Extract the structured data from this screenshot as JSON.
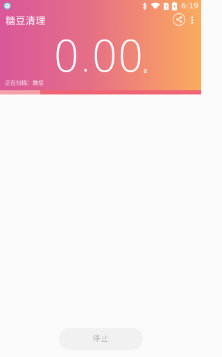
{
  "status_bar": {
    "time": "6:19",
    "icons": [
      "app-notification-icon",
      "bluetooth-icon",
      "wifi-icon",
      "no-sim-icon",
      "battery-charging-icon"
    ]
  },
  "app": {
    "title": "糖豆清理"
  },
  "toolbar": {
    "share_icon": "share-icon",
    "more_icon": "more-vertical-icon"
  },
  "scan": {
    "size_value": "0.00",
    "size_unit": "B",
    "status_text": "正在扫描：微信",
    "progress": 0.2
  },
  "actions": {
    "stop_label": "停止"
  },
  "colors": {
    "gradient_start": "#d9579a",
    "gradient_end": "#f9ac5e",
    "progress_track": "#ef6475",
    "progress_fill": "#f6a1a9",
    "background": "#fafafa",
    "button_bg": "#f1f1f1",
    "button_text": "#b7b7b7"
  }
}
